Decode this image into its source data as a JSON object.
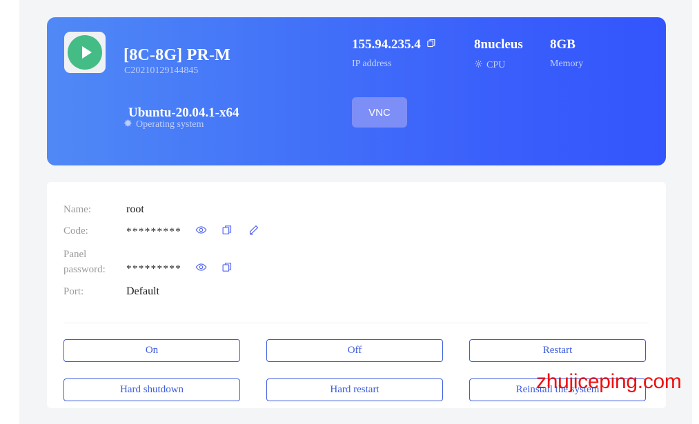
{
  "header": {
    "status_icon": "play-circle-icon",
    "title": "[8C-8G] PR-M",
    "instance_id": "C20210129144845",
    "os_value": "Ubuntu-20.04.1-x64",
    "os_label": "Operating system",
    "os_icon": "gear-icon",
    "stats": [
      {
        "value": "155.94.235.4",
        "caption": "IP address",
        "value_icon": "copy-icon",
        "caption_icon": ""
      },
      {
        "value": "8nucleus",
        "caption": "CPU",
        "value_icon": "",
        "caption_icon": "gear-icon"
      },
      {
        "value": "8GB",
        "caption": "Memory",
        "value_icon": "",
        "caption_icon": ""
      }
    ],
    "vnc_label": "VNC"
  },
  "details": {
    "name_label": "Name:",
    "name_value": "root",
    "code_label": "Code:",
    "code_value": "*********",
    "panel_label_line1": "Panel",
    "panel_label_line2": "password:",
    "panel_value": "*********",
    "port_label": "Port:",
    "port_value": "Default",
    "icons": {
      "eye": "eye-icon",
      "copy": "copy-icon",
      "edit": "pencil-icon"
    }
  },
  "actions": [
    {
      "label": "On"
    },
    {
      "label": "Off"
    },
    {
      "label": "Restart"
    },
    {
      "label": "Hard shutdown"
    },
    {
      "label": "Hard restart"
    },
    {
      "label": "Reinstall the system"
    }
  ],
  "watermark": {
    "text": "zhujiceping.com"
  },
  "colors": {
    "gradient_start": "#5089f6",
    "gradient_end": "#3355fc",
    "status_green": "#44bc86",
    "accent_blue": "#3b5bdb",
    "watermark_red": "#ef1111",
    "page_bg": "#f4f5f7"
  }
}
